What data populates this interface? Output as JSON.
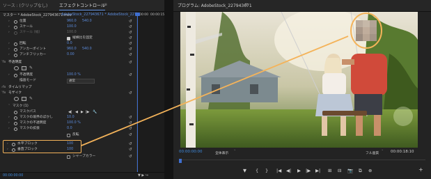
{
  "effect_panel": {
    "tab_source": "ソース : (クリップなし)",
    "tab_effect_controls": "エフェクトコントロール",
    "tab_menu_symbol": "≡",
    "master_clip": "マスター * AdobeStock_227943671.mov",
    "sequence_clip": "AdobeStock_227943671 * AdobeStock_227943...",
    "time_start": "00:00",
    "time_end": "00:00:15",
    "reset_symbol": "↺",
    "rows": [
      {
        "label": "位置",
        "value": "960.0",
        "value2": "540.0"
      },
      {
        "label": "スケール",
        "value": "100.0"
      },
      {
        "label": "スケール (幅)",
        "value": "100.0"
      },
      {
        "checkbox_label": "縦横比を固定"
      },
      {
        "label": "回転",
        "value": "0.0"
      },
      {
        "label": "アンカーポイント",
        "value": "960.0",
        "value2": "540.0"
      },
      {
        "label": "アンチフリッカー",
        "value": "0.00"
      },
      {
        "label": "不透明度"
      },
      {
        "label": "不透明度",
        "value": "100.0 %"
      },
      {
        "label": "描画モード",
        "dropdown": "通常"
      },
      {
        "label": "タイムリマップ"
      },
      {
        "label": "モザイク"
      },
      {
        "label": "マスク (1)"
      },
      {
        "label": "マスクパス"
      },
      {
        "label": "マスクの境界のぼかし",
        "value": "10.0"
      },
      {
        "label": "マスクの不透明度",
        "value": "100.0 %"
      },
      {
        "label": "マスクの拡張",
        "value": "0.0"
      },
      {
        "checkbox_label": "反転"
      },
      {
        "label": "水平ブロック",
        "value": "100"
      },
      {
        "label": "垂直ブロック",
        "value": "100"
      },
      {
        "checkbox_label": "シャープカラー"
      }
    ],
    "fx_symbol": "fx",
    "bottom_timecode": "00:00:00:00",
    "bottom_icons": "▼ ▶ ↪"
  },
  "program_panel": {
    "tab_title": "プログラム: AdobeStock_227943671",
    "tab_menu_symbol": "≡",
    "timecode_current": "00:00:00:00",
    "fit_label": "全体表示",
    "quality_label": "フル画質",
    "timecode_duration": "00:00:18:10",
    "controls": [
      "▼",
      "{",
      "}",
      "|◀",
      "◀|",
      "▶",
      "|▶",
      "▶|",
      "⊞",
      "⊟",
      "📷",
      "⧉",
      "⊕"
    ],
    "add_symbol": "+"
  },
  "colors": {
    "accent_blue": "#3f8be0",
    "highlight_orange": "#f4b35a",
    "panel_bg": "#232323"
  }
}
